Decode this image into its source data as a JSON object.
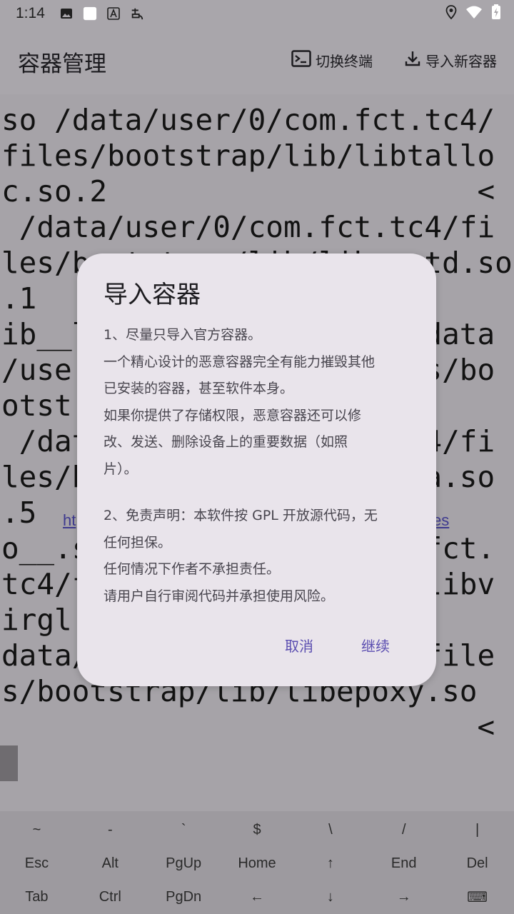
{
  "statusbar": {
    "time": "1:14"
  },
  "appbar": {
    "title": "容器管理",
    "switch_terminal": "切换终端",
    "import_new": "导入新容器"
  },
  "terminal": {
    "lines": [
      "so /data/user/0/com.fct.tc4/",
      "files/bootstrap/lib/libtallo",
      "c.so.2                     <",
      " /data/user/0/com.fct.tc4/fi",
      "les/bootstrap/lib/libc++td.so",
      ".1",
      "ib__l                   data",
      "/user                   s/bo",
      "otstr",
      " /dat                   4/fi",
      "les/b                   a.so",
      ".5",
      "o__.s                   fct.",
      "tc4/f                   libv",
      "irglr",
      "data/                   file",
      "s/bootstrap/lib/libepoxy.so",
      "                           <"
    ],
    "link_left": "ht",
    "link_right": "es"
  },
  "dialog": {
    "title": "导入容器",
    "body": [
      "1、尽量只导入官方容器。",
      "一个精心设计的恶意容器完全有能力摧毁其他",
      "已安装的容器，甚至软件本身。",
      "如果你提供了存储权限，恶意容器还可以修",
      "改、发送、删除设备上的重要数据（如照",
      "片）。",
      "",
      "2、免责声明：本软件按 GPL 开放源代码，无",
      "任何担保。",
      "任何情况下作者不承担责任。",
      "请用户自行审阅代码并承担使用风险。"
    ],
    "cancel": "取消",
    "continue": "继续"
  },
  "keys": {
    "row1": [
      "~",
      "-",
      "`",
      "$",
      "\\",
      "/",
      "|"
    ],
    "row2": [
      "Esc",
      "Alt",
      "PgUp",
      "Home",
      "↑",
      "End",
      "Del"
    ],
    "row3": [
      "Tab",
      "Ctrl",
      "PgDn",
      "←",
      "↓",
      "→",
      "⌨"
    ]
  }
}
